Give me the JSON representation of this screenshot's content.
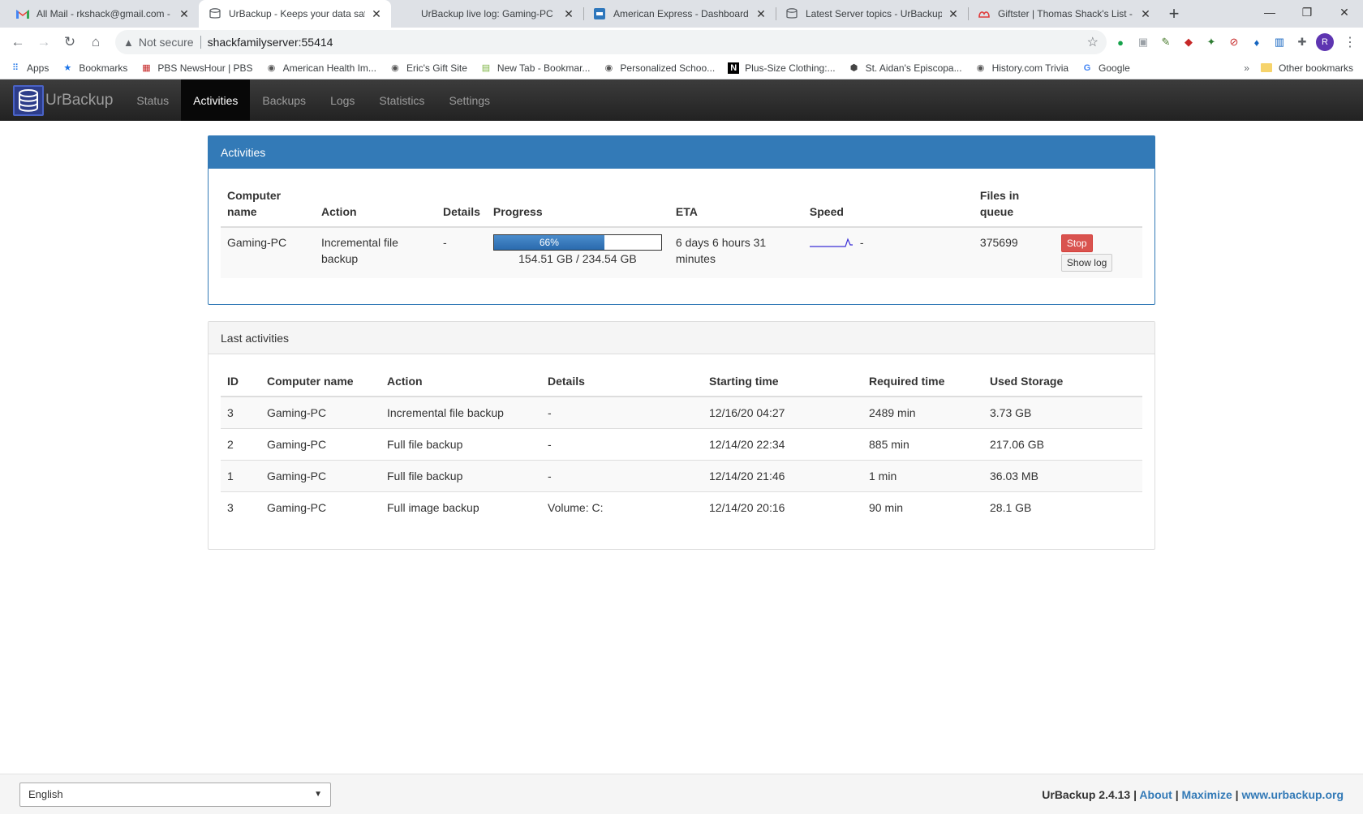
{
  "browser": {
    "tabs": [
      {
        "title": "All Mail - rkshack@gmail.com - G",
        "icon": "gmail-icon"
      },
      {
        "title": "UrBackup - Keeps your data safe",
        "icon": "urbackup-icon"
      },
      {
        "title": "UrBackup live log: Gaming-PC",
        "icon": "none"
      },
      {
        "title": "American Express - Dashboard",
        "icon": "amex-icon"
      },
      {
        "title": "Latest Server topics - UrBackup -",
        "icon": "urbackup-icon"
      },
      {
        "title": "Giftster | Thomas Shack's List - M",
        "icon": "giftster-icon"
      }
    ],
    "security_label": "Not secure",
    "url": "shackfamilyserver:55414",
    "profile_initial": "R",
    "bookmarks": [
      "Apps",
      "Bookmarks",
      "PBS NewsHour | PBS",
      "American Health Im...",
      "Eric's Gift Site",
      "New Tab - Bookmar...",
      "Personalized Schoo...",
      "Plus-Size Clothing:...",
      "St. Aidan's Episcopa...",
      "History.com Trivia",
      "Google"
    ],
    "bookmarks_more": "»",
    "other_bookmarks": "Other bookmarks"
  },
  "app": {
    "brand": "UrBackup",
    "nav": [
      "Status",
      "Activities",
      "Backups",
      "Logs",
      "Statistics",
      "Settings"
    ],
    "active_nav": "Activities"
  },
  "activities": {
    "title": "Activities",
    "headers": [
      "Computer name",
      "Action",
      "Details",
      "Progress",
      "ETA",
      "Speed",
      "Files in queue"
    ],
    "row": {
      "computer": "Gaming-PC",
      "action": "Incremental file backup",
      "details": "-",
      "progress_pct": 66,
      "progress_label": "66%",
      "progress_sub": "154.51 GB / 234.54 GB",
      "eta": "6 days 6 hours 31 minutes",
      "speed": "-",
      "files_in_queue": "375699",
      "stop_label": "Stop",
      "log_label": "Show log"
    }
  },
  "last_activities": {
    "title": "Last activities",
    "headers": [
      "ID",
      "Computer name",
      "Action",
      "Details",
      "Starting time",
      "Required time",
      "Used Storage"
    ],
    "rows": [
      [
        "3",
        "Gaming-PC",
        "Incremental file backup",
        "-",
        "12/16/20 04:27",
        "2489 min",
        "3.73 GB"
      ],
      [
        "2",
        "Gaming-PC",
        "Full file backup",
        "-",
        "12/14/20 22:34",
        "885 min",
        "217.06 GB"
      ],
      [
        "1",
        "Gaming-PC",
        "Full file backup",
        "-",
        "12/14/20 21:46",
        "1 min",
        "36.03 MB"
      ],
      [
        "3",
        "Gaming-PC",
        "Full image backup",
        "Volume: C:",
        "12/14/20 20:16",
        "90 min",
        "28.1 GB"
      ]
    ]
  },
  "footer": {
    "language": "English",
    "version": "UrBackup 2.4.13",
    "links": [
      "About",
      "Maximize",
      "www.urbackup.org"
    ]
  },
  "colors": {
    "primary": "#337ab7",
    "danger": "#d9534f",
    "navbar": "#222222"
  }
}
